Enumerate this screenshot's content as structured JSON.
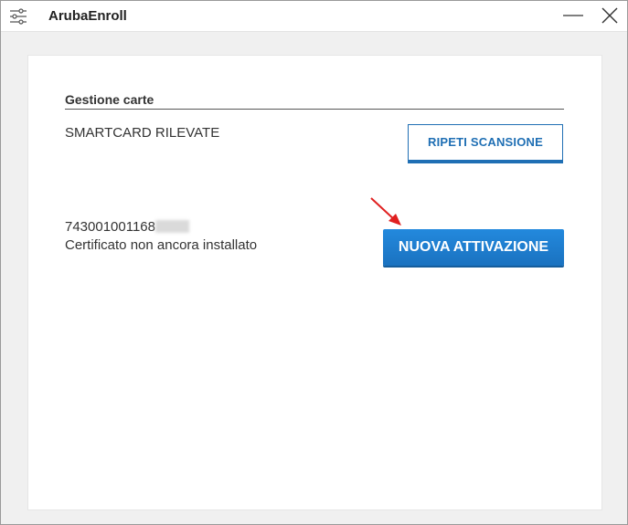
{
  "window": {
    "title": "ArubaEnroll",
    "minimize_icon": "minimize-icon",
    "close_icon": "close-icon",
    "settings_icon": "settings-sliders-icon"
  },
  "section": {
    "title": "Gestione carte",
    "detected_label": "SMARTCARD RILEVATE",
    "rescan_label": "RIPETI SCANSIONE"
  },
  "card": {
    "number_visible": "743001001168",
    "status": "Certificato non ancora installato",
    "activate_label": "NUOVA ATTIVAZIONE"
  },
  "colors": {
    "primary": "#1a7ccc",
    "outline": "#1f6fb4",
    "arrow": "#e02020"
  }
}
